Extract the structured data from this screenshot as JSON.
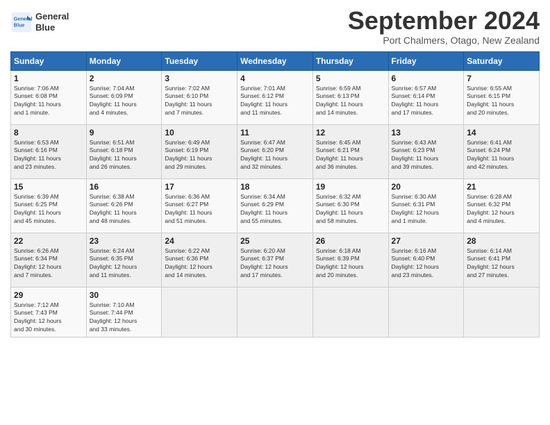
{
  "header": {
    "logo_line1": "General",
    "logo_line2": "Blue",
    "month_title": "September 2024",
    "subtitle": "Port Chalmers, Otago, New Zealand"
  },
  "weekdays": [
    "Sunday",
    "Monday",
    "Tuesday",
    "Wednesday",
    "Thursday",
    "Friday",
    "Saturday"
  ],
  "weeks": [
    [
      {
        "day": 1,
        "info": "Sunrise: 7:06 AM\nSunset: 6:08 PM\nDaylight: 11 hours\nand 1 minute."
      },
      {
        "day": 2,
        "info": "Sunrise: 7:04 AM\nSunset: 6:09 PM\nDaylight: 11 hours\nand 4 minutes."
      },
      {
        "day": 3,
        "info": "Sunrise: 7:02 AM\nSunset: 6:10 PM\nDaylight: 11 hours\nand 7 minutes."
      },
      {
        "day": 4,
        "info": "Sunrise: 7:01 AM\nSunset: 6:12 PM\nDaylight: 11 hours\nand 11 minutes."
      },
      {
        "day": 5,
        "info": "Sunrise: 6:59 AM\nSunset: 6:13 PM\nDaylight: 11 hours\nand 14 minutes."
      },
      {
        "day": 6,
        "info": "Sunrise: 6:57 AM\nSunset: 6:14 PM\nDaylight: 11 hours\nand 17 minutes."
      },
      {
        "day": 7,
        "info": "Sunrise: 6:55 AM\nSunset: 6:15 PM\nDaylight: 11 hours\nand 20 minutes."
      }
    ],
    [
      {
        "day": 8,
        "info": "Sunrise: 6:53 AM\nSunset: 6:16 PM\nDaylight: 11 hours\nand 23 minutes."
      },
      {
        "day": 9,
        "info": "Sunrise: 6:51 AM\nSunset: 6:18 PM\nDaylight: 11 hours\nand 26 minutes."
      },
      {
        "day": 10,
        "info": "Sunrise: 6:49 AM\nSunset: 6:19 PM\nDaylight: 11 hours\nand 29 minutes."
      },
      {
        "day": 11,
        "info": "Sunrise: 6:47 AM\nSunset: 6:20 PM\nDaylight: 11 hours\nand 32 minutes."
      },
      {
        "day": 12,
        "info": "Sunrise: 6:45 AM\nSunset: 6:21 PM\nDaylight: 11 hours\nand 36 minutes."
      },
      {
        "day": 13,
        "info": "Sunrise: 6:43 AM\nSunset: 6:23 PM\nDaylight: 11 hours\nand 39 minutes."
      },
      {
        "day": 14,
        "info": "Sunrise: 6:41 AM\nSunset: 6:24 PM\nDaylight: 11 hours\nand 42 minutes."
      }
    ],
    [
      {
        "day": 15,
        "info": "Sunrise: 6:39 AM\nSunset: 6:25 PM\nDaylight: 11 hours\nand 45 minutes."
      },
      {
        "day": 16,
        "info": "Sunrise: 6:38 AM\nSunset: 6:26 PM\nDaylight: 11 hours\nand 48 minutes."
      },
      {
        "day": 17,
        "info": "Sunrise: 6:36 AM\nSunset: 6:27 PM\nDaylight: 11 hours\nand 51 minutes."
      },
      {
        "day": 18,
        "info": "Sunrise: 6:34 AM\nSunset: 6:29 PM\nDaylight: 11 hours\nand 55 minutes."
      },
      {
        "day": 19,
        "info": "Sunrise: 6:32 AM\nSunset: 6:30 PM\nDaylight: 11 hours\nand 58 minutes."
      },
      {
        "day": 20,
        "info": "Sunrise: 6:30 AM\nSunset: 6:31 PM\nDaylight: 12 hours\nand 1 minute."
      },
      {
        "day": 21,
        "info": "Sunrise: 6:28 AM\nSunset: 6:32 PM\nDaylight: 12 hours\nand 4 minutes."
      }
    ],
    [
      {
        "day": 22,
        "info": "Sunrise: 6:26 AM\nSunset: 6:34 PM\nDaylight: 12 hours\nand 7 minutes."
      },
      {
        "day": 23,
        "info": "Sunrise: 6:24 AM\nSunset: 6:35 PM\nDaylight: 12 hours\nand 11 minutes."
      },
      {
        "day": 24,
        "info": "Sunrise: 6:22 AM\nSunset: 6:36 PM\nDaylight: 12 hours\nand 14 minutes."
      },
      {
        "day": 25,
        "info": "Sunrise: 6:20 AM\nSunset: 6:37 PM\nDaylight: 12 hours\nand 17 minutes."
      },
      {
        "day": 26,
        "info": "Sunrise: 6:18 AM\nSunset: 6:39 PM\nDaylight: 12 hours\nand 20 minutes."
      },
      {
        "day": 27,
        "info": "Sunrise: 6:16 AM\nSunset: 6:40 PM\nDaylight: 12 hours\nand 23 minutes."
      },
      {
        "day": 28,
        "info": "Sunrise: 6:14 AM\nSunset: 6:41 PM\nDaylight: 12 hours\nand 27 minutes."
      }
    ],
    [
      {
        "day": 29,
        "info": "Sunrise: 7:12 AM\nSunset: 7:43 PM\nDaylight: 12 hours\nand 30 minutes."
      },
      {
        "day": 30,
        "info": "Sunrise: 7:10 AM\nSunset: 7:44 PM\nDaylight: 12 hours\nand 33 minutes."
      },
      null,
      null,
      null,
      null,
      null
    ]
  ]
}
